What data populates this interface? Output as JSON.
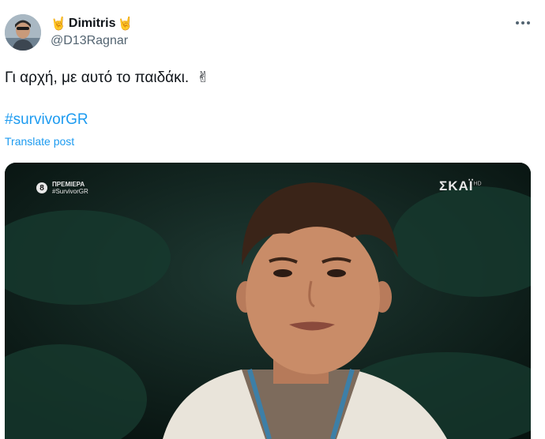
{
  "author": {
    "name": "Dimitris",
    "name_prefix_emoji": "🤘",
    "name_suffix_emoji": "🤘",
    "handle": "@D13Ragnar",
    "avatar_icon": "profile-photo"
  },
  "menu": {
    "icon": "more-horizontal-icon"
  },
  "post": {
    "text": "Γι αρχή, με αυτό το παιδάκι.",
    "text_emoji": "✌",
    "hashtag": "#survivorGR",
    "translate_label": "Translate post"
  },
  "media": {
    "broadcast_channel_number": "8",
    "broadcast_premiere": "ΠΡΕΜΙΕΡΑ",
    "broadcast_hashtag": "#SurvivorGR",
    "channel_logo": "ΣΚΑΪ",
    "channel_logo_hd": "HD"
  },
  "colors": {
    "link": "#1d9bf0",
    "secondary_text": "#536471",
    "primary_text": "#0f1419"
  }
}
